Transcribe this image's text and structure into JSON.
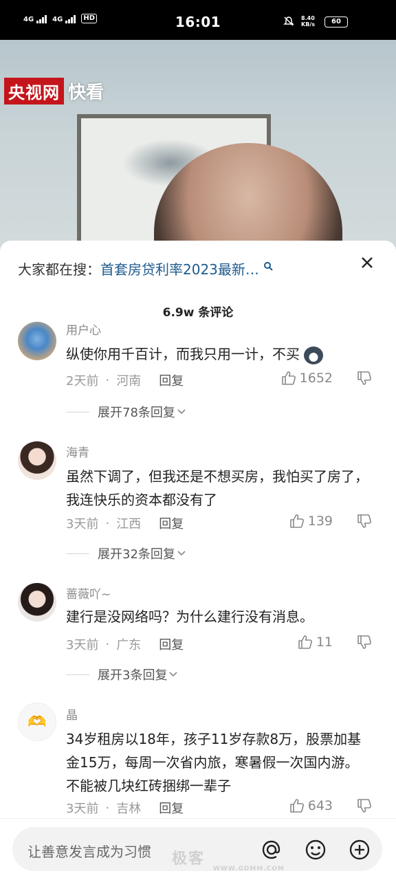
{
  "status_bar": {
    "net1": "4G",
    "net2": "4G",
    "hd": "HD",
    "time": "16:01",
    "speed_value": "8.40",
    "speed_unit": "KB/s",
    "battery": "60"
  },
  "video": {
    "logo_main": "央视网",
    "logo_sub": "快看"
  },
  "sheet": {
    "search_prefix": "大家都在搜：",
    "search_term": "首套房贷利率2023最新…",
    "comment_count": "6.9w 条评论"
  },
  "comments": [
    {
      "user": "用户心",
      "text": "纵使你用千百计，而我只用一计，不买",
      "time": "2天前",
      "location": "河南",
      "reply": "回复",
      "likes": "1652",
      "expand": "展开78条回复"
    },
    {
      "user": "海青",
      "text": "虽然下调了，但我还是不想买房，我怕买了房了，我连快乐的资本都没有了",
      "time": "3天前",
      "location": "江西",
      "reply": "回复",
      "likes": "139",
      "expand": "展开32条回复"
    },
    {
      "user": "蔷薇吖~",
      "text": "建行是没网络吗？为什么建行没有消息。",
      "time": "3天前",
      "location": "广东",
      "reply": "回复",
      "likes": "11",
      "expand": "展开3条回复"
    },
    {
      "user": "晶",
      "text": "34岁租房以18年，孩子11岁存款8万，股票加基金15万，每周一次省内旅，寒暑假一次国内游。不能被几块红砖捆绑一辈子",
      "time": "3天前",
      "location": "吉林",
      "reply": "回复",
      "likes": "643"
    }
  ],
  "input_bar": {
    "placeholder": "让善意发言成为习惯",
    "watermark": "极客",
    "watermark_url": "WWW.GDMM.COM"
  },
  "icons": {
    "search": "search-icon",
    "close": "close-icon",
    "like": "thumbs-up-icon",
    "dislike": "thumbs-down-icon",
    "at": "at-icon",
    "emoji": "emoji-icon",
    "add": "plus-icon"
  },
  "colors": {
    "search_link": "#1d5a8c",
    "logo_red": "#c4151c"
  }
}
